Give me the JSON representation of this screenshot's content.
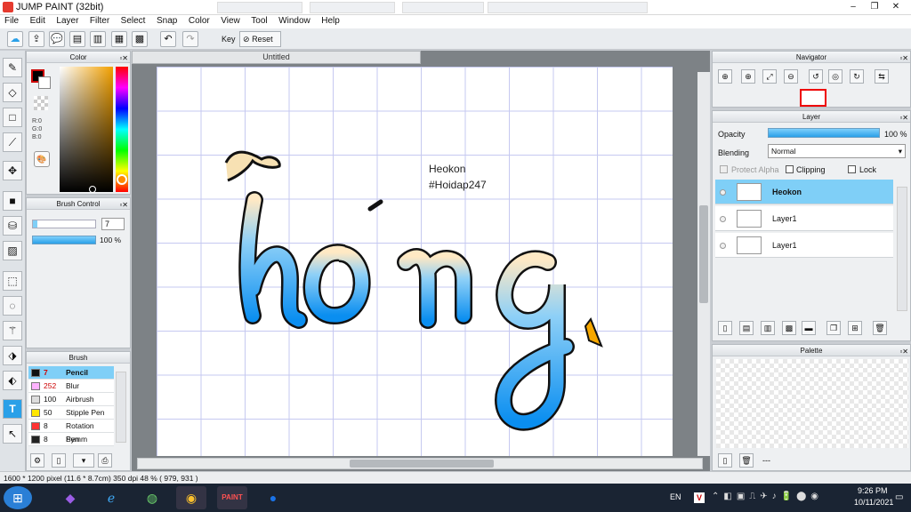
{
  "app": {
    "title": "JUMP PAINT (32bit)"
  },
  "menu": [
    "File",
    "Edit",
    "Layer",
    "Filter",
    "Select",
    "Snap",
    "Color",
    "View",
    "Tool",
    "Window",
    "Help"
  ],
  "toolbar": {
    "key_label": "Key",
    "reset_label": "Reset"
  },
  "document": {
    "tab_label": "Untitled",
    "text_line1": "Heokon",
    "text_line2": "#Hoidap247",
    "art_word": "hóng"
  },
  "color_panel": {
    "title": "Color",
    "r": "R:0",
    "g": "G:0",
    "b": "B:0",
    "primary": "#000000",
    "secondary": "#ffffff"
  },
  "brush_control": {
    "title": "Brush Control",
    "size": "7",
    "opacity": "100 %"
  },
  "brush_panel": {
    "title": "Brush",
    "items": [
      {
        "size": "7",
        "name": "Pencil",
        "color": "#111111"
      },
      {
        "size": "252",
        "name": "Blur",
        "color": "#ffb3ff"
      },
      {
        "size": "100",
        "name": "Airbrush",
        "color": "#dddddd"
      },
      {
        "size": "50",
        "name": "Stipple Pen",
        "color": "#ffe600"
      },
      {
        "size": "8",
        "name": "Rotation Symm",
        "color": "#ff3333"
      },
      {
        "size": "8",
        "name": "Pen",
        "color": "#222222"
      }
    ]
  },
  "navigator": {
    "title": "Navigator"
  },
  "layer_panel": {
    "title": "Layer",
    "opacity_label": "Opacity",
    "opacity_value": "100 %",
    "blending_label": "Blending",
    "blending_value": "Normal",
    "protect_alpha": "Protect Alpha",
    "clipping": "Clipping",
    "lock": "Lock",
    "layers": [
      {
        "name": "Heokon"
      },
      {
        "name": "Layer1"
      },
      {
        "name": "Layer1"
      }
    ]
  },
  "palette": {
    "title": "Palette",
    "dots": "---"
  },
  "status": {
    "text": "1600 * 1200 pixel  (11.6 * 8.7cm)  350 dpi  48 %  ( 979, 931 )"
  },
  "taskbar": {
    "lang": "EN",
    "time": "9:26 PM",
    "date": "10/11/2021"
  },
  "colors": {
    "accent": "#2aa0e8",
    "selected_row": "#7fcff7"
  }
}
